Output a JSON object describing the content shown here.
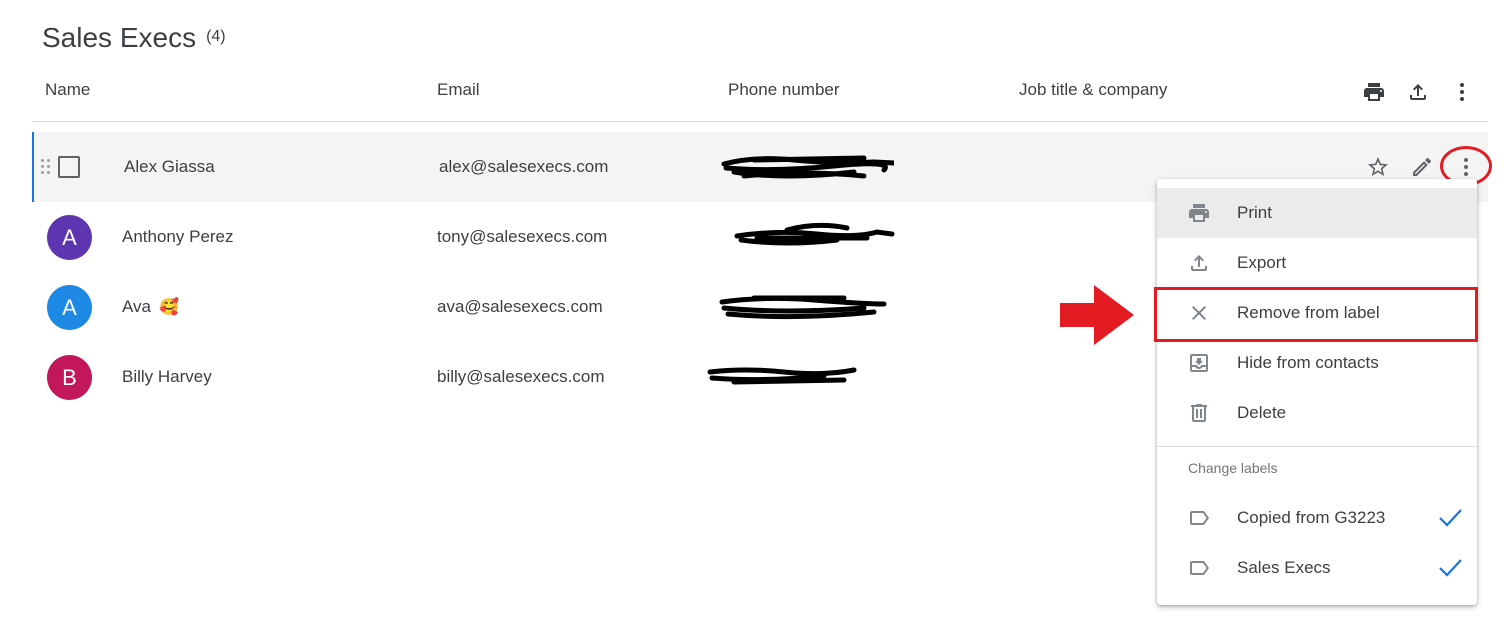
{
  "page": {
    "title": "Sales Execs",
    "count": "(4)"
  },
  "columns": {
    "name": "Name",
    "email": "Email",
    "phone": "Phone number",
    "job": "Job title & company"
  },
  "header_actions": [
    "print-icon",
    "export-icon",
    "more-vert-icon"
  ],
  "contacts": [
    {
      "name": "Alex Giassa",
      "email": "alex@salesexecs.com",
      "avatar_letter": "",
      "avatar_color": "",
      "selected": true
    },
    {
      "name": "Anthony Perez",
      "email": "tony@salesexecs.com",
      "avatar_letter": "A",
      "avatar_color": "#5e35b1"
    },
    {
      "name": "Ava",
      "emoji": "🥰",
      "email": "ava@salesexecs.com",
      "avatar_letter": "A",
      "avatar_color": "#1e88e5"
    },
    {
      "name": "Billy Harvey",
      "email": "billy@salesexecs.com",
      "avatar_letter": "B",
      "avatar_color": "#c2185b"
    }
  ],
  "row_actions": [
    "star-icon",
    "edit-icon",
    "more-vert-icon"
  ],
  "menu": {
    "items": [
      {
        "label": "Print",
        "icon": "print-icon"
      },
      {
        "label": "Export",
        "icon": "export-icon"
      },
      {
        "label": "Remove from label",
        "icon": "close-icon"
      },
      {
        "label": "Hide from contacts",
        "icon": "archive-icon"
      },
      {
        "label": "Delete",
        "icon": "trash-icon"
      }
    ],
    "section_label": "Change labels",
    "labels": [
      {
        "label": "Copied from G3223",
        "icon": "label-icon",
        "checked": true
      },
      {
        "label": "Sales Execs",
        "icon": "label-icon",
        "checked": true
      }
    ]
  },
  "colors": {
    "accent": "#1a73e8",
    "annotation_red": "#e31b23"
  }
}
